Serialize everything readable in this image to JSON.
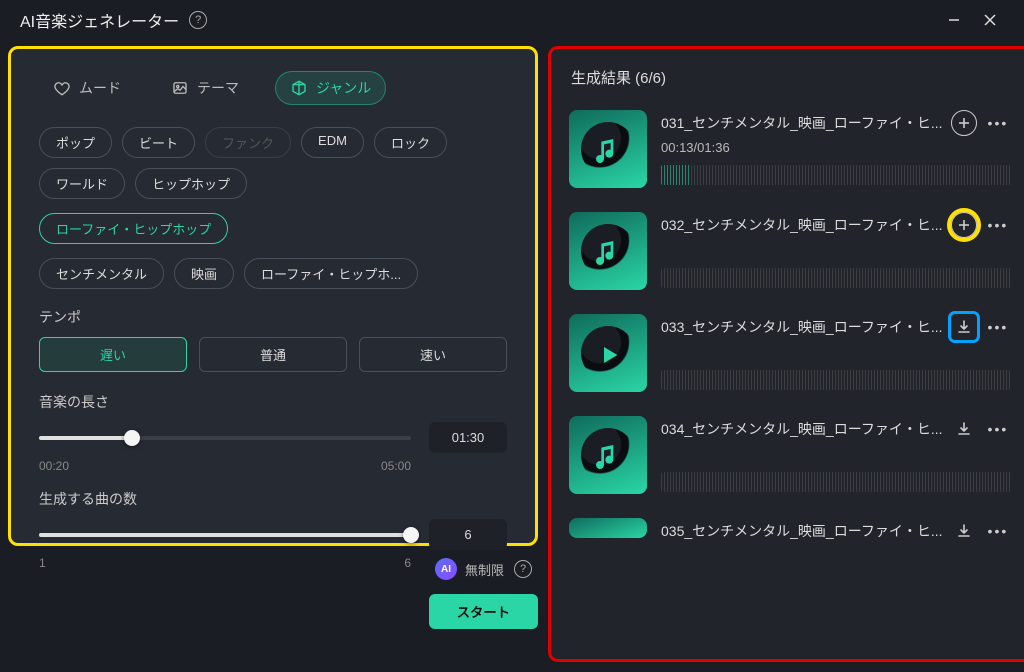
{
  "app": {
    "title": "AI音楽ジェネレーター"
  },
  "tabs": {
    "mood": {
      "label": "ムード"
    },
    "theme": {
      "label": "テーマ"
    },
    "genre": {
      "label": "ジャンル"
    }
  },
  "genres": {
    "pop": "ポップ",
    "beat": "ビート",
    "funk": "ファンク",
    "edm": "EDM",
    "rock": "ロック",
    "world": "ワールド",
    "hiphop": "ヒップホップ",
    "lofi": "ローファイ・ヒップホップ"
  },
  "selected_tags": {
    "sentimental": "センチメンタル",
    "movie": "映画",
    "lofi": "ローファイ・ヒップホ..."
  },
  "tempo": {
    "label": "テンポ",
    "slow": "遅い",
    "normal": "普通",
    "fast": "速い"
  },
  "length": {
    "label": "音楽の長さ",
    "min": "00:20",
    "max": "05:00",
    "value": "01:30"
  },
  "count": {
    "label": "生成する曲の数",
    "min": "1",
    "max": "6",
    "value": "6"
  },
  "unlimited": {
    "label": "無制限"
  },
  "start": {
    "label": "スタート"
  },
  "results": {
    "header": "生成結果 (6/6)",
    "tracks": [
      {
        "title": "031_センチメンタル_映画_ローファイ・ヒ...",
        "time": "00:13/01:36",
        "action": "add",
        "playing": true
      },
      {
        "title": "032_センチメンタル_映画_ローファイ・ヒ...",
        "action": "add",
        "highlight": "yellow"
      },
      {
        "title": "033_センチメンタル_映画_ローファイ・ヒ...",
        "action": "download",
        "highlight": "blue"
      },
      {
        "title": "034_センチメンタル_映画_ローファイ・ヒ...",
        "action": "download"
      },
      {
        "title": "035_センチメンタル_映画_ローファイ・ヒ...",
        "action": "download"
      }
    ]
  }
}
